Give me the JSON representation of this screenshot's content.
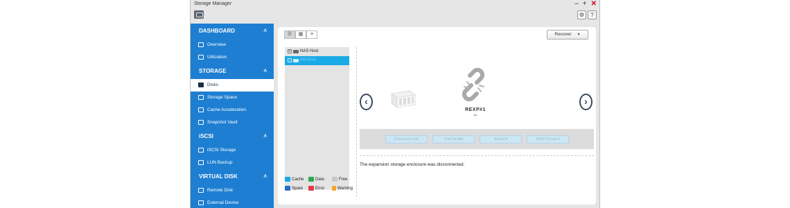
{
  "window": {
    "title": "Storage Manager",
    "controls": {
      "minimize": "–",
      "maximize": "+",
      "close": "✕"
    }
  },
  "toolbar": {
    "settings_icon": "gear-icon",
    "help_label": "?"
  },
  "sidebar": {
    "sections": [
      {
        "title": "DASHBOARD",
        "items": [
          {
            "label": "Overview",
            "icon": "monitor-icon"
          },
          {
            "label": "Utilization",
            "icon": "chart-icon"
          }
        ]
      },
      {
        "title": "STORAGE",
        "items": [
          {
            "label": "Disks",
            "icon": "disk-icon",
            "active": true
          },
          {
            "label": "Storage Space",
            "icon": "storage-icon"
          },
          {
            "label": "Cache Acceleration",
            "icon": "cache-icon"
          },
          {
            "label": "Snapshot Vault",
            "icon": "vault-icon"
          }
        ]
      },
      {
        "title": "iSCSI",
        "items": [
          {
            "label": "iSCSI Storage",
            "icon": "iscsi-icon"
          },
          {
            "label": "LUN Backup",
            "icon": "backup-icon"
          }
        ]
      },
      {
        "title": "VIRTUAL DISK",
        "items": [
          {
            "label": "Remote Disk",
            "icon": "remote-disk-icon"
          },
          {
            "label": "External Device",
            "icon": "external-device-icon"
          }
        ]
      }
    ]
  },
  "main": {
    "recover_label": "Recover",
    "tree": [
      {
        "label": "NAS Host",
        "selected": false
      },
      {
        "label": "REXP#1",
        "selected": true
      }
    ],
    "enclosure": {
      "name": "REXP#1",
      "status": "--"
    },
    "actions": [
      "Enclosure Info",
      "Disk Health",
      "Action",
      "RAID Group"
    ],
    "message": "The expansion storage enclosure was disconnected.",
    "legend": [
      {
        "label": "Cache",
        "color": "#19a9e5"
      },
      {
        "label": "Data",
        "color": "#2fa84f"
      },
      {
        "label": "Free",
        "color": "#c8c8c8"
      },
      {
        "label": "Spare",
        "color": "#2a6fc9"
      },
      {
        "label": "Error",
        "color": "#e23b4a"
      },
      {
        "label": "Warning",
        "color": "#f5a623"
      }
    ]
  }
}
